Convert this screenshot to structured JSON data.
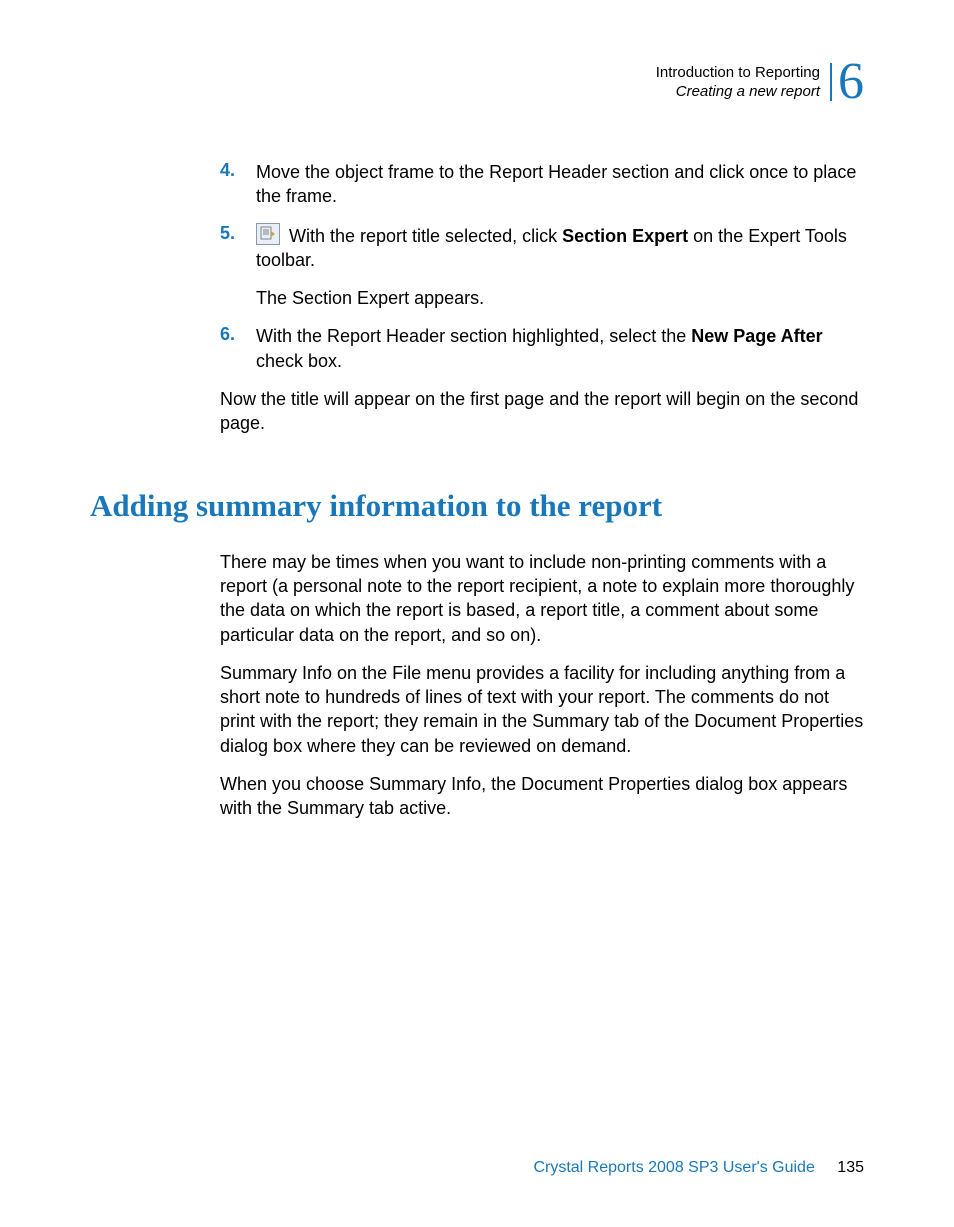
{
  "header": {
    "chapter_title": "Introduction to Reporting",
    "section_title": "Creating a new report",
    "chapter_number": "6"
  },
  "steps": {
    "s4": {
      "num": "4.",
      "text": "Move the object frame to the Report Header section and click once to place the frame."
    },
    "s5": {
      "num": "5.",
      "pre": " With the report title selected, click ",
      "bold": "Section Expert",
      "post": " on the Expert Tools toolbar.",
      "follow": "The Section Expert appears."
    },
    "s6": {
      "num": "6.",
      "pre": "With the Report Header section highlighted, select the ",
      "bold": "New Page After",
      "post": " check box."
    }
  },
  "after_steps": "Now the title will appear on the first page and the report will begin on the second page.",
  "heading": "Adding summary information to the report",
  "paras": {
    "p1": "There may be times when you want to include non-printing comments with a report (a personal note to the report recipient, a note to explain more thoroughly the data on which the report is based, a report title, a comment about some particular data on the report, and so on).",
    "p2": "Summary Info on the File menu provides a facility for including anything from a short note to hundreds of lines of text with your report. The comments do not print with the report; they remain in the Summary tab of the Document Properties dialog box where they can be reviewed on demand.",
    "p3": "When you choose Summary Info, the Document Properties dialog box appears with the Summary tab active."
  },
  "footer": {
    "guide": "Crystal Reports 2008 SP3 User's Guide",
    "page": "135"
  }
}
